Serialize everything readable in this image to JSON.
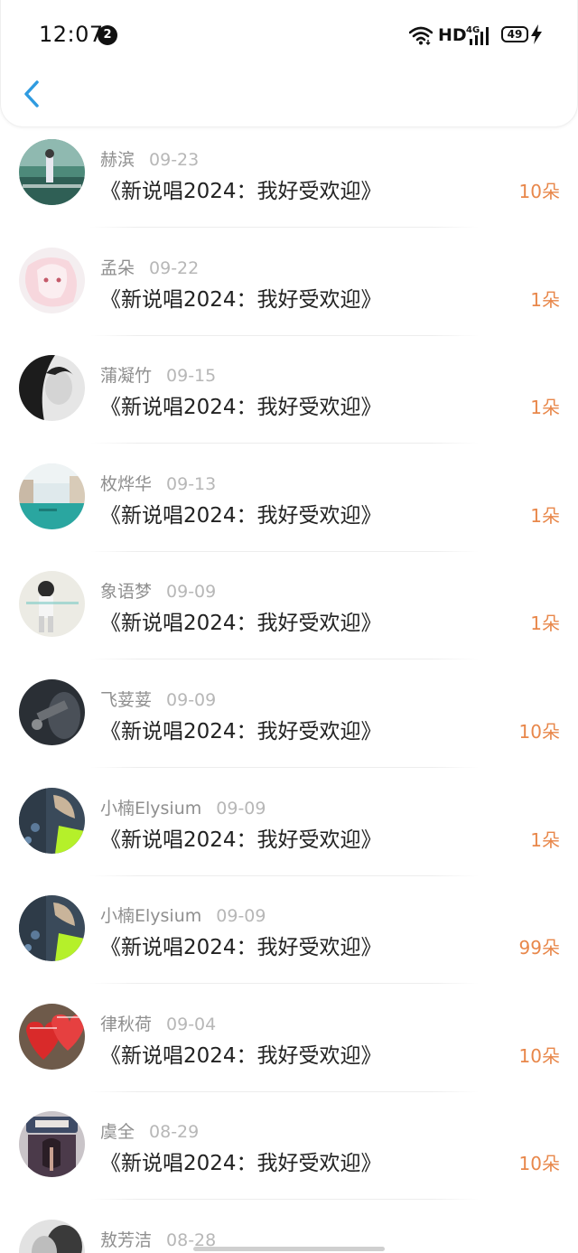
{
  "status_bar": {
    "time": "12:07",
    "notification_count": "2",
    "network_label": "HD",
    "signal_type": "4G",
    "battery_level": "49",
    "icons": [
      "wifi-icon",
      "signal-icon",
      "battery-icon",
      "charging-bolt-icon"
    ]
  },
  "nav": {
    "back_icon": "chevron-left-icon",
    "accent_color": "#2f9be0"
  },
  "theme": {
    "count_color": "#e8874a",
    "title_color": "#222222",
    "meta_color": "#999999"
  },
  "gifts": [
    {
      "user": "赫滨",
      "date": "09-23",
      "title": "《新说唱2024：我好受欢迎》",
      "count": "10朵"
    },
    {
      "user": "孟朵",
      "date": "09-22",
      "title": "《新说唱2024：我好受欢迎》",
      "count": "1朵"
    },
    {
      "user": "蒲凝竹",
      "date": "09-15",
      "title": "《新说唱2024：我好受欢迎》",
      "count": "1朵"
    },
    {
      "user": "枚烨华",
      "date": "09-13",
      "title": "《新说唱2024：我好受欢迎》",
      "count": "1朵"
    },
    {
      "user": "象语梦",
      "date": "09-09",
      "title": "《新说唱2024：我好受欢迎》",
      "count": "1朵"
    },
    {
      "user": "飞荽荽",
      "date": "09-09",
      "title": "《新说唱2024：我好受欢迎》",
      "count": "10朵"
    },
    {
      "user": "小楠Elysium",
      "date": "09-09",
      "title": "《新说唱2024：我好受欢迎》",
      "count": "1朵"
    },
    {
      "user": "小楠Elysium",
      "date": "09-09",
      "title": "《新说唱2024：我好受欢迎》",
      "count": "99朵"
    },
    {
      "user": "律秋荷",
      "date": "09-04",
      "title": "《新说唱2024：我好受欢迎》",
      "count": "10朵"
    },
    {
      "user": "虞全",
      "date": "08-29",
      "title": "《新说唱2024：我好受欢迎》",
      "count": "10朵"
    },
    {
      "user": "敖芳洁",
      "date": "08-28",
      "title": "",
      "count": ""
    }
  ]
}
